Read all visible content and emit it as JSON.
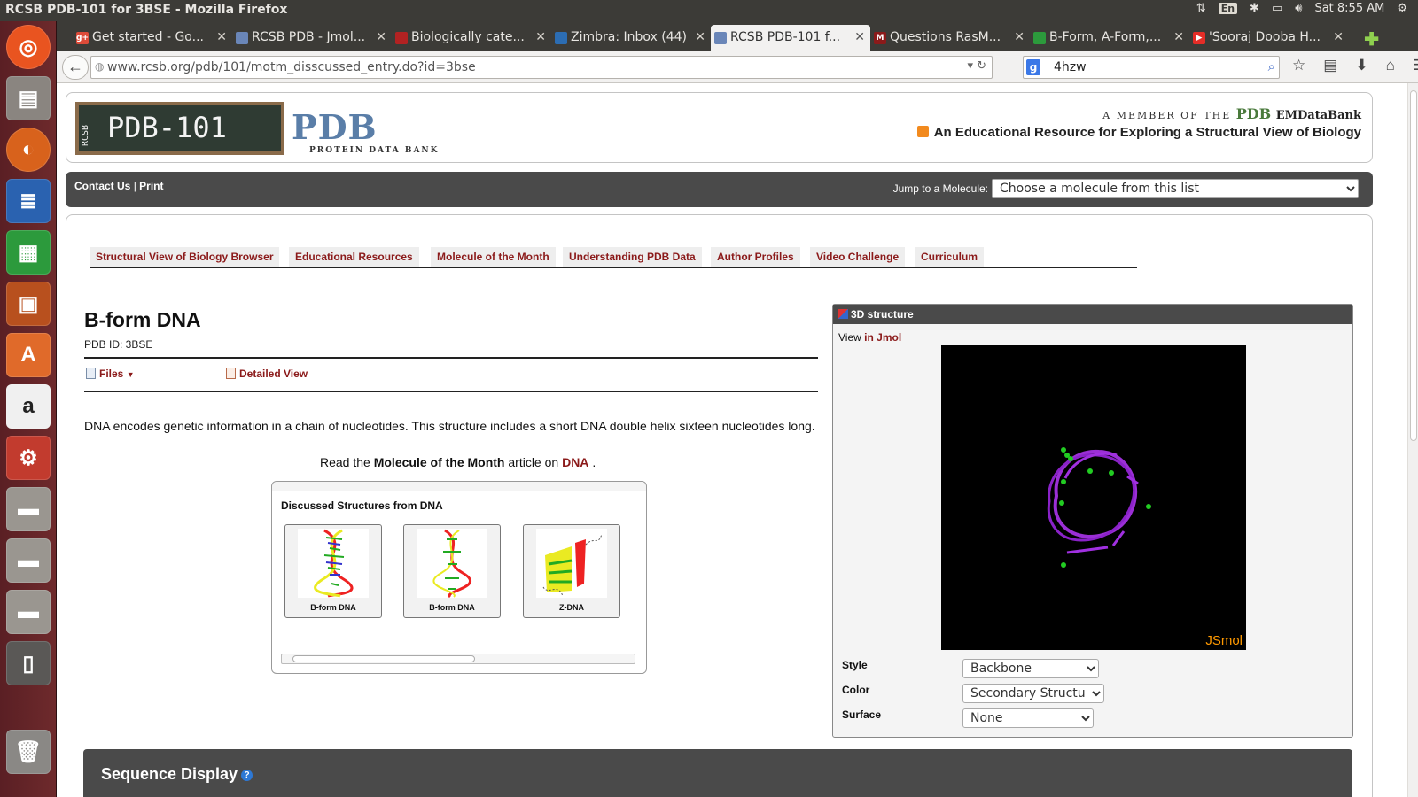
{
  "window": {
    "title": "RCSB PDB-101 for 3BSE - Mozilla Firefox"
  },
  "system_tray": {
    "language": "En",
    "clock": "Sat  8:55 AM"
  },
  "tabs": [
    {
      "label": "Get started - Go...",
      "favicon_color": "#dd4b39",
      "favicon_text": "g+"
    },
    {
      "label": "RCSB PDB - Jmol...",
      "favicon_color": "#6a86b8",
      "favicon_text": ""
    },
    {
      "label": "Biologically cate...",
      "favicon_color": "#b22222",
      "favicon_text": ""
    },
    {
      "label": "Zimbra: Inbox (44)",
      "favicon_color": "#2c6db3",
      "favicon_text": ""
    },
    {
      "label": "RCSB PDB-101 f...",
      "favicon_color": "#6a86b8",
      "favicon_text": ""
    },
    {
      "label": "Questions RasM...",
      "favicon_color": "#8b1a1a",
      "favicon_text": "M"
    },
    {
      "label": "B-Form, A-Form,...",
      "favicon_color": "#2c9a3c",
      "favicon_text": ""
    },
    {
      "label": "'Sooraj Dooba H...",
      "favicon_color": "#e52d27",
      "favicon_text": "▶"
    }
  ],
  "navbar": {
    "url": "www.rcsb.org/pdb/101/motm_disscussed_entry.do?id=3bse",
    "search_value": "4hzw"
  },
  "header": {
    "logo_text": "PDB-101",
    "logo_small": "RCSB",
    "pdb_logo": "PDB",
    "pdb_sub": "PROTEIN DATA BANK",
    "member_text": "A MEMBER OF THE",
    "member_pdb": "PDB",
    "member_emdb": "EMDataBank",
    "tagline": "An Educational Resource for Exploring a Structural View of Biology"
  },
  "topbar": {
    "contact": "Contact Us",
    "separator": "|",
    "print": "Print",
    "jump_label": "Jump to a Molecule:",
    "jump_value": "Choose a molecule from this list"
  },
  "site_tabs": [
    "Structural View of Biology Browser",
    "Educational Resources",
    "Molecule of the Month",
    "Understanding PDB Data",
    "Author Profiles",
    "Video Challenge",
    "Curriculum"
  ],
  "entry": {
    "title": "B-form DNA",
    "pdb_id": "PDB ID: 3BSE",
    "files_label": "Files",
    "detailed_label": "Detailed View",
    "description": "DNA encodes genetic information in a chain of nucleotides. This structure includes a short DNA double helix sixteen nucleotides long.",
    "read_prefix": "Read the",
    "read_motm": "Molecule of the Month",
    "read_mid": "article on",
    "read_link": "DNA",
    "read_suffix": "."
  },
  "discussed": {
    "title": "Discussed Structures from DNA",
    "items": [
      "B-form DNA",
      "B-form DNA",
      "Z-DNA"
    ]
  },
  "structure_panel": {
    "title": "3D structure",
    "view_prefix": "View",
    "view_link": "in Jmol",
    "jsmol_brand": "JSmol",
    "style_label": "Style",
    "style_value": "Backbone",
    "color_label": "Color",
    "color_value": "Secondary Structure",
    "surface_label": "Surface",
    "surface_value": "None"
  },
  "sequence": {
    "title": "Sequence Display",
    "help": "?"
  }
}
